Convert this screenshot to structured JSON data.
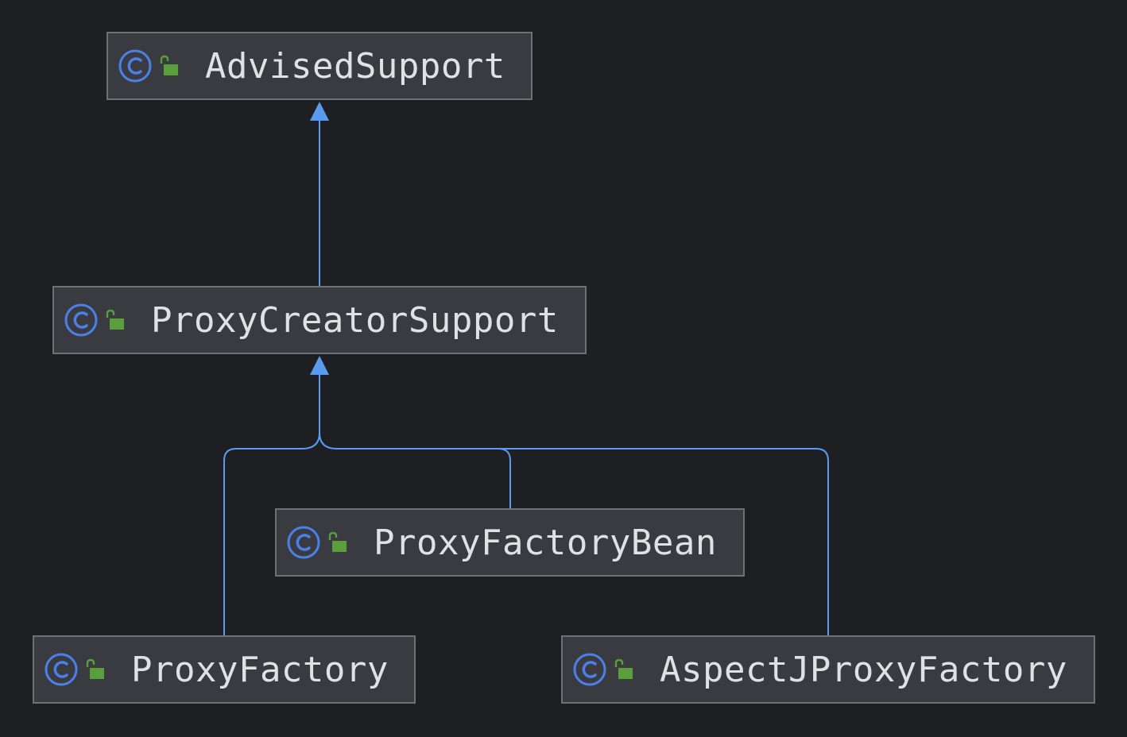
{
  "diagram": {
    "nodes": [
      {
        "id": "advised",
        "label": "AdvisedSupport",
        "icons": [
          "class-icon",
          "public-lock-icon"
        ]
      },
      {
        "id": "pcs",
        "label": "ProxyCreatorSupport",
        "icons": [
          "class-icon",
          "public-lock-icon"
        ]
      },
      {
        "id": "pfb",
        "label": "ProxyFactoryBean",
        "icons": [
          "class-icon",
          "public-lock-icon"
        ]
      },
      {
        "id": "pf",
        "label": "ProxyFactory",
        "icons": [
          "class-icon",
          "public-lock-icon"
        ]
      },
      {
        "id": "ajpf",
        "label": "AspectJProxyFactory",
        "icons": [
          "class-icon",
          "public-lock-icon"
        ]
      }
    ],
    "edges": [
      {
        "from": "pcs",
        "to": "advised",
        "type": "extends"
      },
      {
        "from": "pf",
        "to": "pcs",
        "type": "extends"
      },
      {
        "from": "pfb",
        "to": "pcs",
        "type": "extends"
      },
      {
        "from": "ajpf",
        "to": "pcs",
        "type": "extends"
      }
    ],
    "colors": {
      "background": "#1e1f22",
      "node_fill": "#393b40",
      "node_border": "#6e7074",
      "text": "#dfe1e5",
      "edge": "#5a9bf0",
      "class_icon": "#4a80e8",
      "lock_icon": "#5a9e3c"
    }
  }
}
